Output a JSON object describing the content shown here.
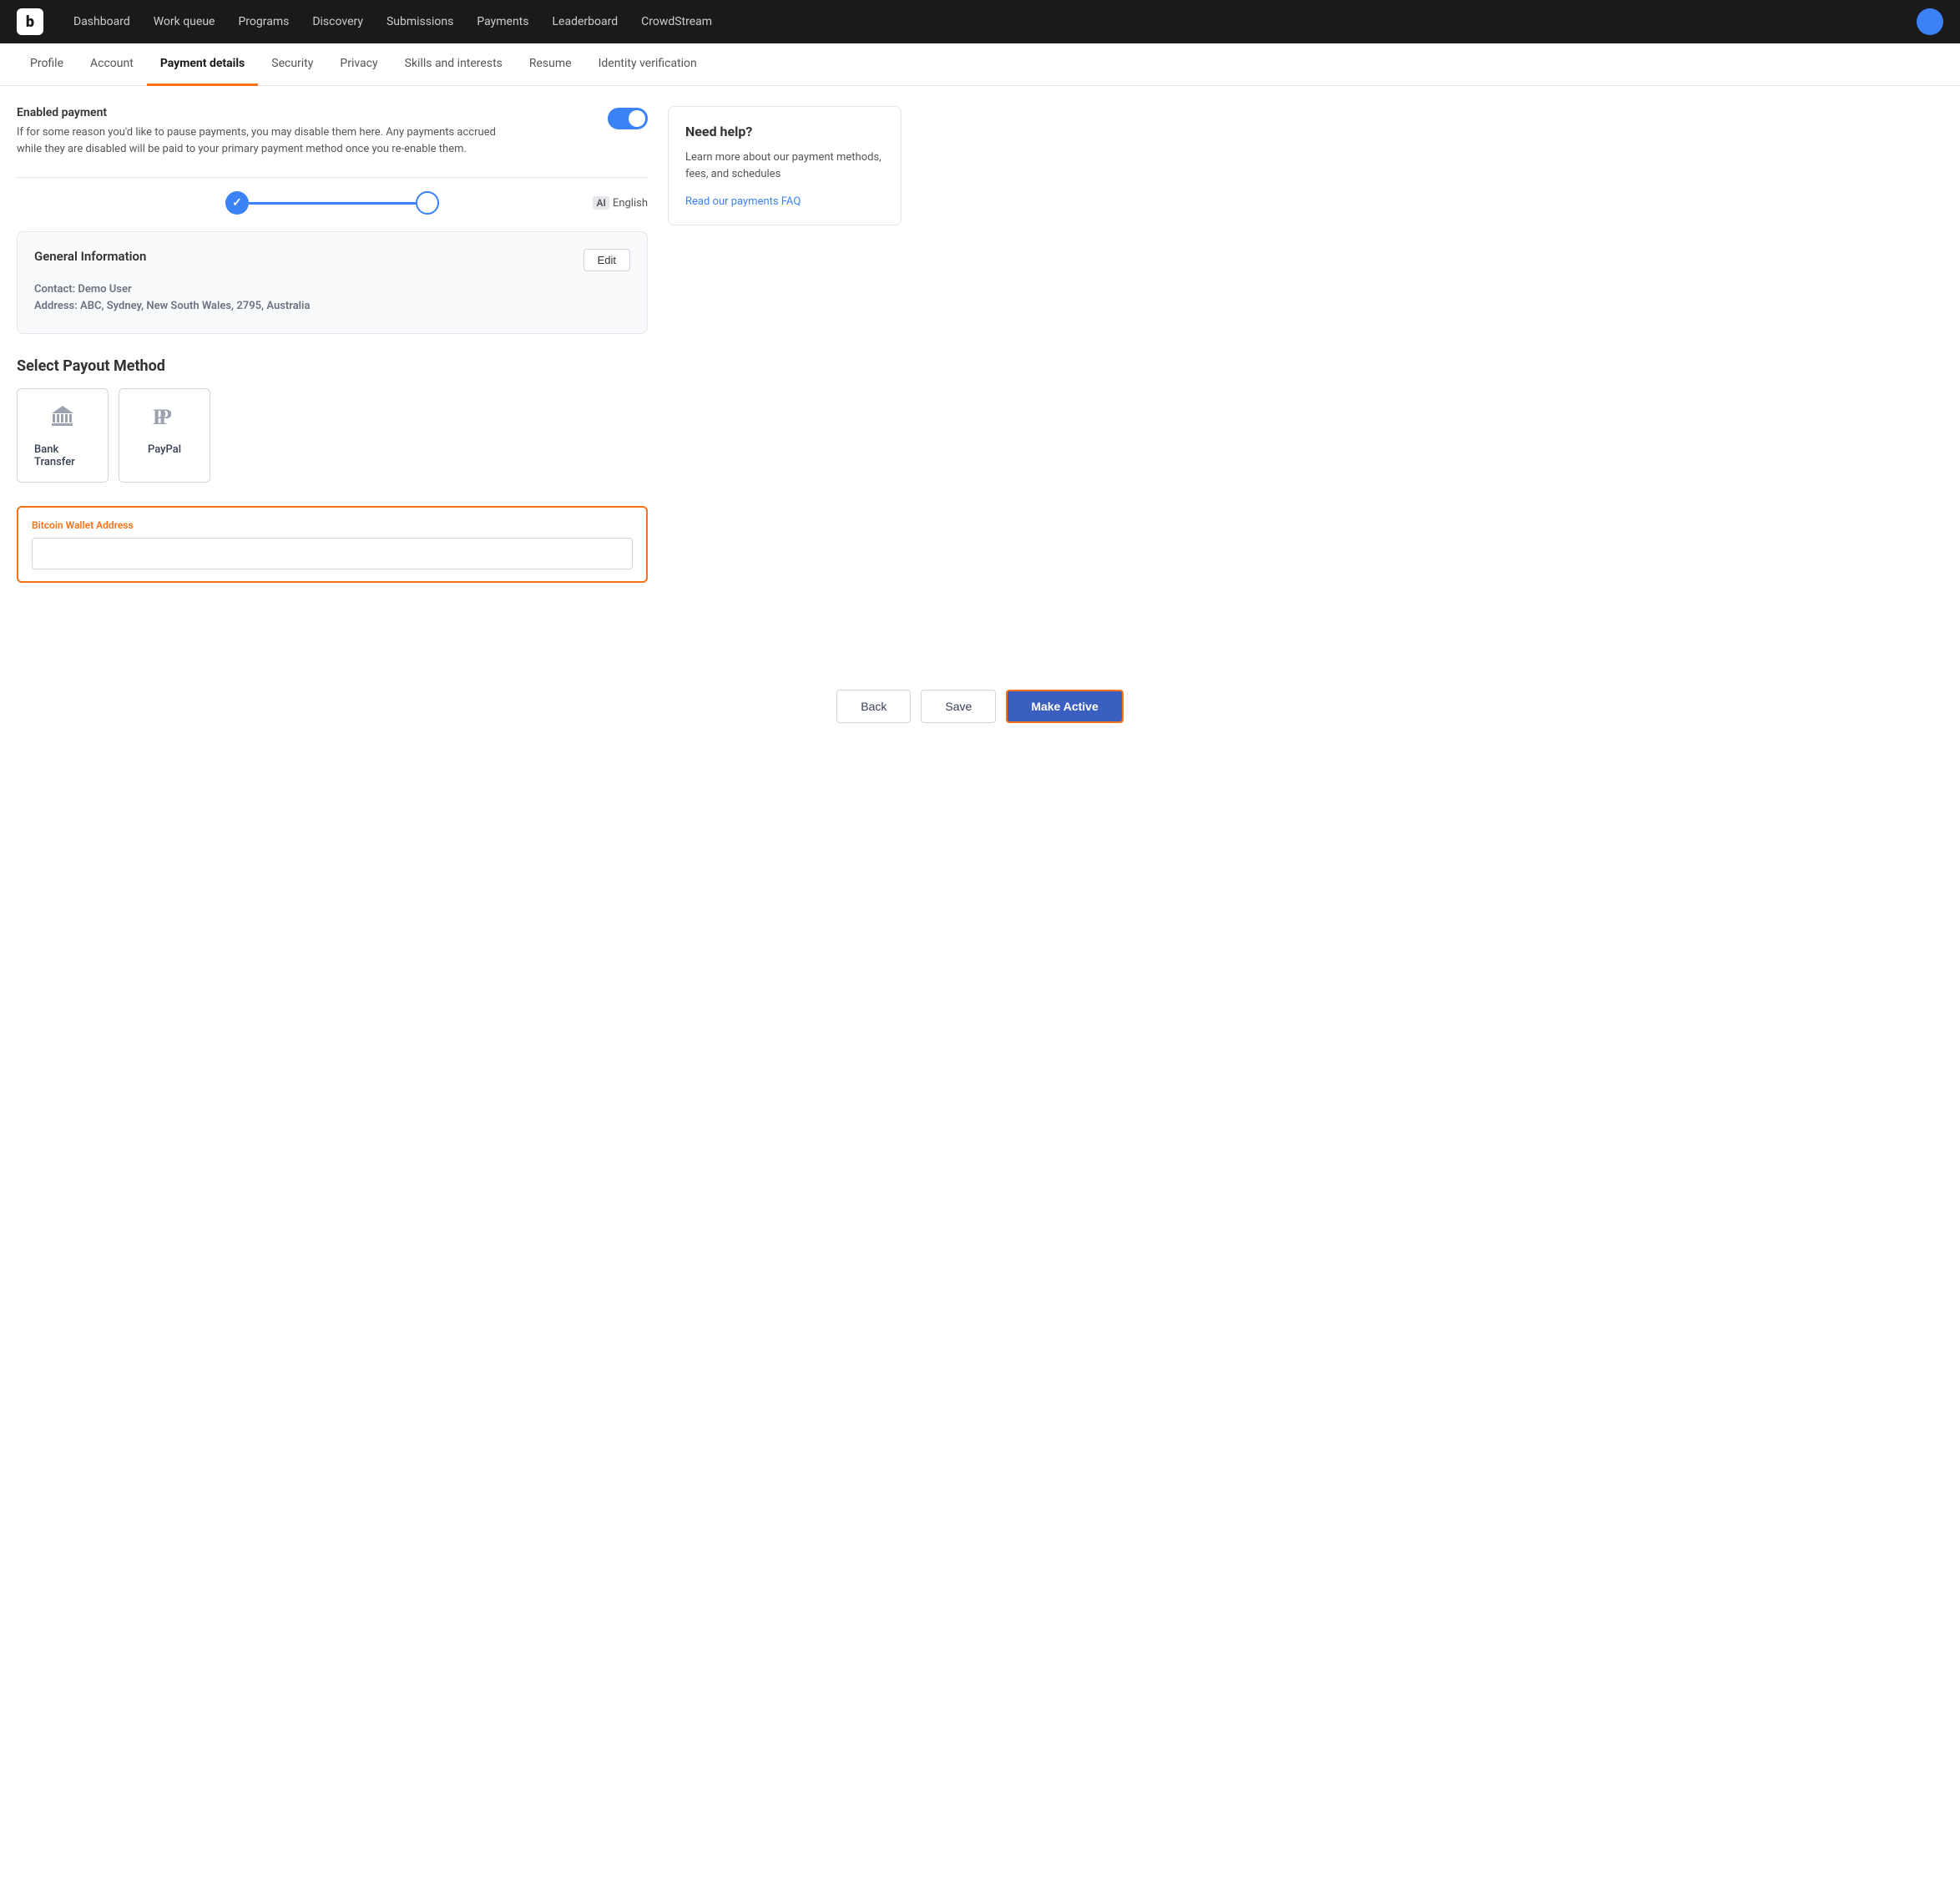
{
  "topnav": {
    "logo": "b",
    "links": [
      {
        "label": "Dashboard",
        "href": "#"
      },
      {
        "label": "Work queue",
        "href": "#"
      },
      {
        "label": "Programs",
        "href": "#"
      },
      {
        "label": "Discovery",
        "href": "#"
      },
      {
        "label": "Submissions",
        "href": "#"
      },
      {
        "label": "Payments",
        "href": "#"
      },
      {
        "label": "Leaderboard",
        "href": "#"
      },
      {
        "label": "CrowdStream",
        "href": "#"
      }
    ]
  },
  "subnav": {
    "items": [
      {
        "label": "Profile",
        "active": false
      },
      {
        "label": "Account",
        "active": false
      },
      {
        "label": "Payment details",
        "active": true
      },
      {
        "label": "Security",
        "active": false
      },
      {
        "label": "Privacy",
        "active": false
      },
      {
        "label": "Skills and interests",
        "active": false
      },
      {
        "label": "Resume",
        "active": false
      },
      {
        "label": "Identity verification",
        "active": false
      }
    ]
  },
  "enabled_payment": {
    "title": "Enabled payment",
    "description": "If for some reason you'd like to pause payments, you may disable them here. Any payments accrued while they are disabled will be paid to your primary payment method once you re-enable them."
  },
  "language": {
    "label": "English",
    "icon": "AI"
  },
  "general_info": {
    "title": "General Information",
    "edit_label": "Edit",
    "contact_label": "Contact:",
    "contact_value": "Demo User",
    "address_label": "Address:",
    "address_value": "ABC, Sydney, New South Wales, 2795, Australia"
  },
  "select_payout": {
    "title": "Select Payout Method",
    "methods": [
      {
        "label": "Bank Transfer",
        "icon": "bank"
      },
      {
        "label": "PayPal",
        "icon": "paypal"
      }
    ]
  },
  "bitcoin": {
    "label": "Bitcoin Wallet Address",
    "placeholder": ""
  },
  "help": {
    "title": "Need help?",
    "description": "Learn more about our payment methods, fees, and schedules",
    "link_label": "Read our payments FAQ"
  },
  "actions": {
    "back_label": "Back",
    "save_label": "Save",
    "make_active_label": "Make Active"
  }
}
